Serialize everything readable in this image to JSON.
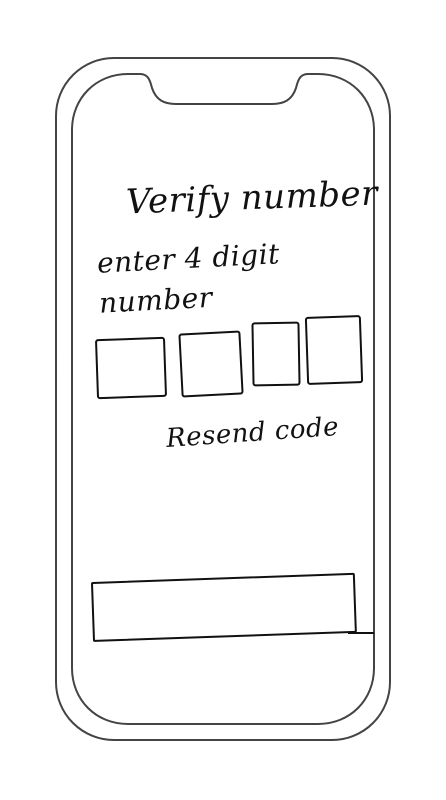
{
  "screen": {
    "title": "Verify number",
    "instruction": "enter 4 digit number",
    "otp_digits": [
      "",
      "",
      "",
      ""
    ],
    "resend_label": "Resend code",
    "cta_label": ""
  },
  "colors": {
    "ink": "#111111",
    "background": "#ffffff",
    "phone_outline": "#444444"
  }
}
